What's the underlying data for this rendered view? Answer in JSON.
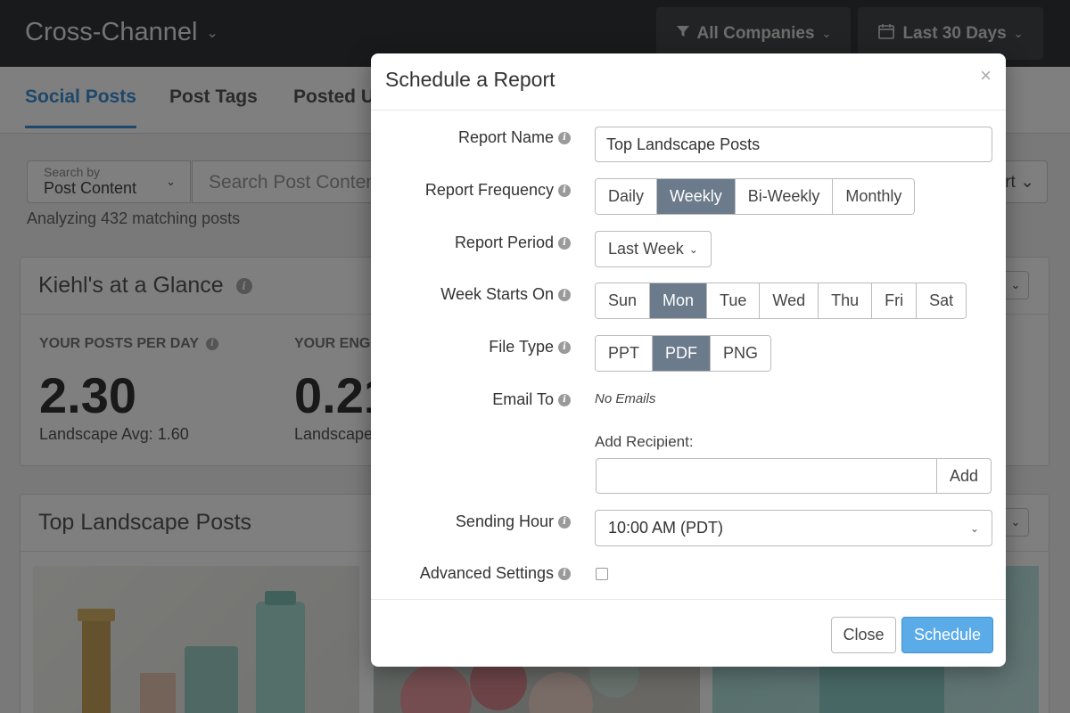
{
  "app": {
    "title": "Cross-Channel",
    "companies_label": "All Companies",
    "range_label": "Last 30 Days"
  },
  "tabs": [
    {
      "label": "Social Posts",
      "active": true
    },
    {
      "label": "Post Tags",
      "active": false
    },
    {
      "label": "Posted U",
      "active": false
    }
  ],
  "search": {
    "by_small": "Search by",
    "by_value": "Post Content",
    "placeholder": "Search Post Conten",
    "right_text": "rt"
  },
  "analyzing_text": "Analyzing 432 matching posts",
  "glance": {
    "title": "Kiehl's at a Glance",
    "stats": [
      {
        "label": "YOUR POSTS PER DAY",
        "value": "2.30",
        "sub": "Landscape Avg: 1.60"
      },
      {
        "label": "YOUR ENG.",
        "value": "0.21",
        "sub": "Landscape"
      }
    ]
  },
  "top_posts": {
    "title": "Top Landscape Posts"
  },
  "modal": {
    "title": "Schedule a Report",
    "close_glyph": "×",
    "report_name": {
      "label": "Report Name",
      "value": "Top Landscape Posts"
    },
    "frequency": {
      "label": "Report Frequency",
      "options": [
        "Daily",
        "Weekly",
        "Bi-Weekly",
        "Monthly"
      ],
      "selected": "Weekly"
    },
    "period": {
      "label": "Report Period",
      "value": "Last Week"
    },
    "week_start": {
      "label": "Week Starts On",
      "options": [
        "Sun",
        "Mon",
        "Tue",
        "Wed",
        "Thu",
        "Fri",
        "Sat"
      ],
      "selected": "Mon"
    },
    "file_type": {
      "label": "File Type",
      "options": [
        "PPT",
        "PDF",
        "PNG"
      ],
      "selected": "PDF"
    },
    "email": {
      "label": "Email To",
      "none_text": "No Emails",
      "add_label": "Add Recipient:",
      "add_button": "Add"
    },
    "sending_hour": {
      "label": "Sending Hour",
      "value": "10:00 AM (PDT)"
    },
    "advanced": {
      "label": "Advanced Settings",
      "checked": false
    },
    "buttons": {
      "close": "Close",
      "schedule": "Schedule"
    }
  },
  "colors": {
    "accent": "#3a8fd6",
    "selected_option": "#6b7b8c",
    "primary_button": "#5aabe8",
    "topbar": "#323436"
  },
  "icons": {
    "chevron": "chevron-down-icon",
    "filter": "filter-icon",
    "calendar": "calendar-icon",
    "info": "info-icon",
    "close": "close-icon"
  }
}
